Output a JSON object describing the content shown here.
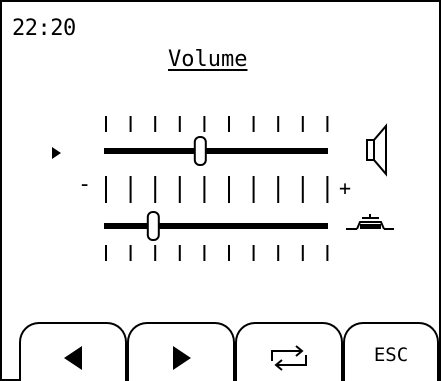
{
  "status_bar": {
    "time": "22:20"
  },
  "header": {
    "title": "Volume"
  },
  "sliders": [
    {
      "id": "volume",
      "level": 0.43,
      "selected": true,
      "icon": "speaker-icon"
    },
    {
      "id": "keyclick",
      "level": 0.22,
      "selected": false,
      "icon": "key-click-icon"
    }
  ],
  "scale": {
    "min_symbol": "-",
    "max_symbol": "+"
  },
  "softkeys": [
    {
      "id": "left",
      "icon": "left-arrow-icon"
    },
    {
      "id": "right",
      "icon": "right-arrow-icon"
    },
    {
      "id": "toggle",
      "icon": "cycle-icon"
    },
    {
      "id": "esc",
      "label": "ESC"
    }
  ]
}
